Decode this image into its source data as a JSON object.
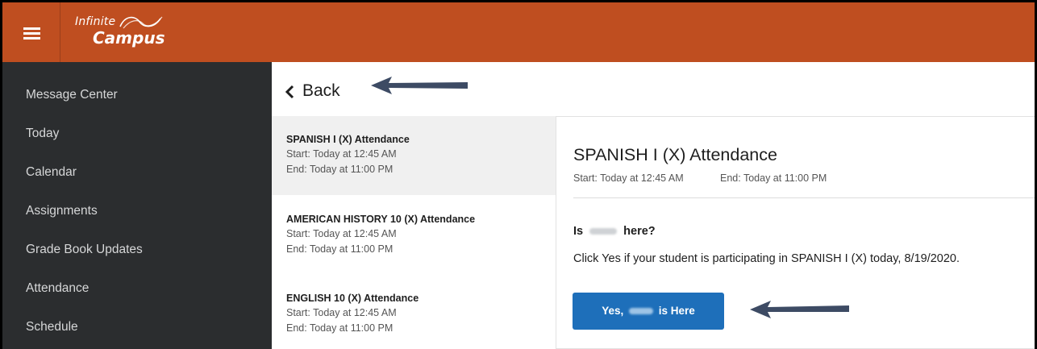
{
  "app": {
    "logo_line1": "Infinite",
    "logo_line2": "Campus",
    "header_color": "#bf4e20"
  },
  "sidebar": {
    "items": [
      {
        "label": "Message Center"
      },
      {
        "label": "Today"
      },
      {
        "label": "Calendar"
      },
      {
        "label": "Assignments"
      },
      {
        "label": "Grade Book Updates"
      },
      {
        "label": "Attendance"
      },
      {
        "label": "Schedule"
      }
    ]
  },
  "back": {
    "label": "Back"
  },
  "list": {
    "items": [
      {
        "title": "SPANISH I (X) Attendance",
        "start": "Start: Today at 12:45 AM",
        "end": "End: Today at 11:00 PM"
      },
      {
        "title": "AMERICAN HISTORY 10 (X) Attendance",
        "start": "Start: Today at 12:45 AM",
        "end": "End: Today at 11:00 PM"
      },
      {
        "title": "ENGLISH 10 (X) Attendance",
        "start": "Start: Today at 12:45 AM",
        "end": "End: Today at 11:00 PM"
      }
    ]
  },
  "detail": {
    "title": "SPANISH I (X) Attendance",
    "start": "Start: Today at 12:45 AM",
    "end": "End: Today at 11:00 PM",
    "question_prefix": "Is",
    "question_suffix": "here?",
    "instruction": "Click Yes if your student is participating in SPANISH I (X) today, 8/19/2020.",
    "button_prefix": "Yes,",
    "button_suffix": "is Here",
    "button_color": "#1e6fba"
  },
  "annotations": {
    "arrow_color": "#3d4b64"
  }
}
